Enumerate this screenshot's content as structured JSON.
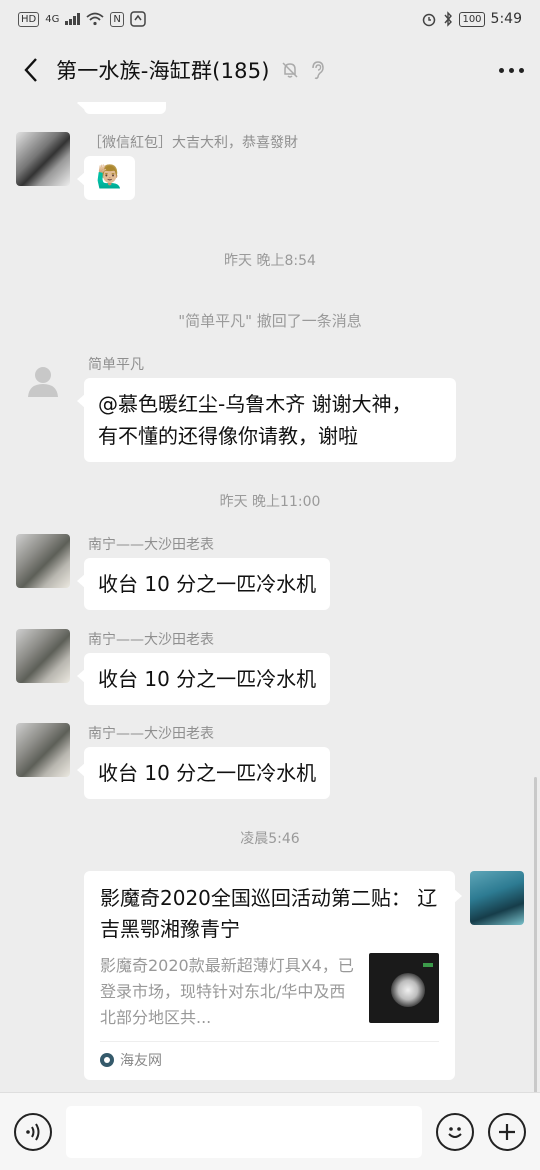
{
  "status_bar": {
    "left_badge": "HD",
    "network": "4G",
    "nfc": "N",
    "battery": "100",
    "time": "5:49"
  },
  "header": {
    "title": "第一水族-海缸群(185)"
  },
  "messages": {
    "top_partial_bubble": "",
    "redpacket": {
      "sender": "［微信紅包］大吉大利，恭喜發財",
      "text": "🙋🏼‍♂️"
    },
    "time1": "昨天 晚上8:54",
    "recall_notice": "\"简单平凡\" 撤回了一条消息",
    "msg_simple": {
      "sender": "简单平凡",
      "text_line1": "@慕色暖红尘-乌鲁木齐  谢谢大神，",
      "text_line2": "有不懂的还得像你请教，谢啦"
    },
    "time2": "昨天 晚上11:00",
    "msg_nanning": [
      {
        "sender": "南宁——大沙田老表",
        "text": "收台 10 分之一匹冷水机"
      },
      {
        "sender": "南宁——大沙田老表",
        "text": "收台 10 分之一匹冷水机"
      },
      {
        "sender": "南宁——大沙田老表",
        "text": "收台 10 分之一匹冷水机"
      }
    ],
    "time3": "凌晨5:46",
    "card": {
      "title": "影魔奇2020全国巡回活动第二贴： 辽吉黑鄂湘豫青宁",
      "description": "影魔奇2020款最新超薄灯具X4，已登录市场，现特针对东北/华中及西北部分地区共...",
      "source": "海友网"
    }
  },
  "input_bar": {
    "placeholder": ""
  },
  "icons": {
    "back": "back-arrow-icon",
    "mute": "bell-off-icon",
    "ear": "ear-icon",
    "more": "more-icon",
    "voice": "voice-icon",
    "emoji": "emoji-icon",
    "plus": "plus-icon"
  }
}
